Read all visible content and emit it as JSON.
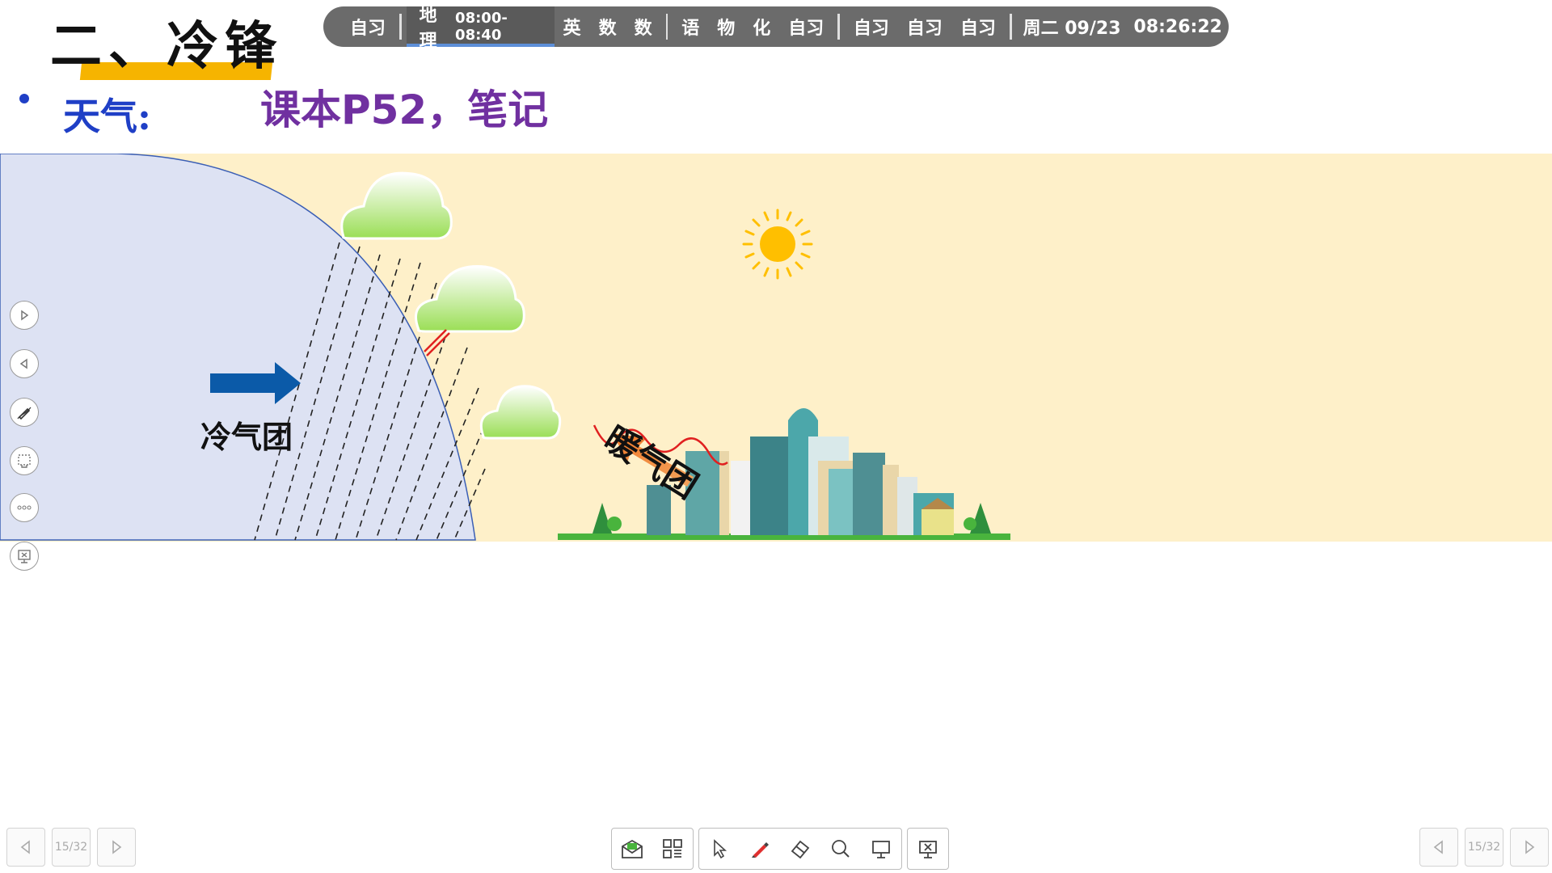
{
  "slide": {
    "title": "二、冷锋",
    "weather_label": "天气:",
    "textbook_ref": "课本P52，笔记"
  },
  "schedule": {
    "items_before": [
      "自习"
    ],
    "current_subject": "地理",
    "current_time": "08:00-08:40",
    "items_group2": [
      "英",
      "数",
      "数"
    ],
    "items_group3": [
      "语",
      "物",
      "化",
      "自习"
    ],
    "items_group4": [
      "自习",
      "自习",
      "自习"
    ],
    "date": "周二 09/23",
    "clock": "08:26:22"
  },
  "diagram": {
    "cold_air_mass_label": "冷气团",
    "warm_air_mass_label": "暖气团"
  },
  "side_tools": [
    "play-forward-icon",
    "play-back-icon",
    "pen-icon",
    "screen-capture-icon",
    "more-icon",
    "exit-icon"
  ],
  "bottom_toolbar": {
    "tools": [
      "mail-icon",
      "qr-grid-icon",
      "pointer-icon",
      "pen-icon",
      "eraser-icon",
      "zoom-icon",
      "present-icon",
      "close-presentation-icon"
    ]
  },
  "pager": {
    "page_indicator": "15/32"
  },
  "colors": {
    "cold_region": "#dde2f3",
    "warm_region": "#fef0c9",
    "title_underline": "#f6b400",
    "weather_label": "#1f3fc6",
    "textbook_ref": "#7030a0",
    "schedule_bar": "#6b6b6b"
  }
}
